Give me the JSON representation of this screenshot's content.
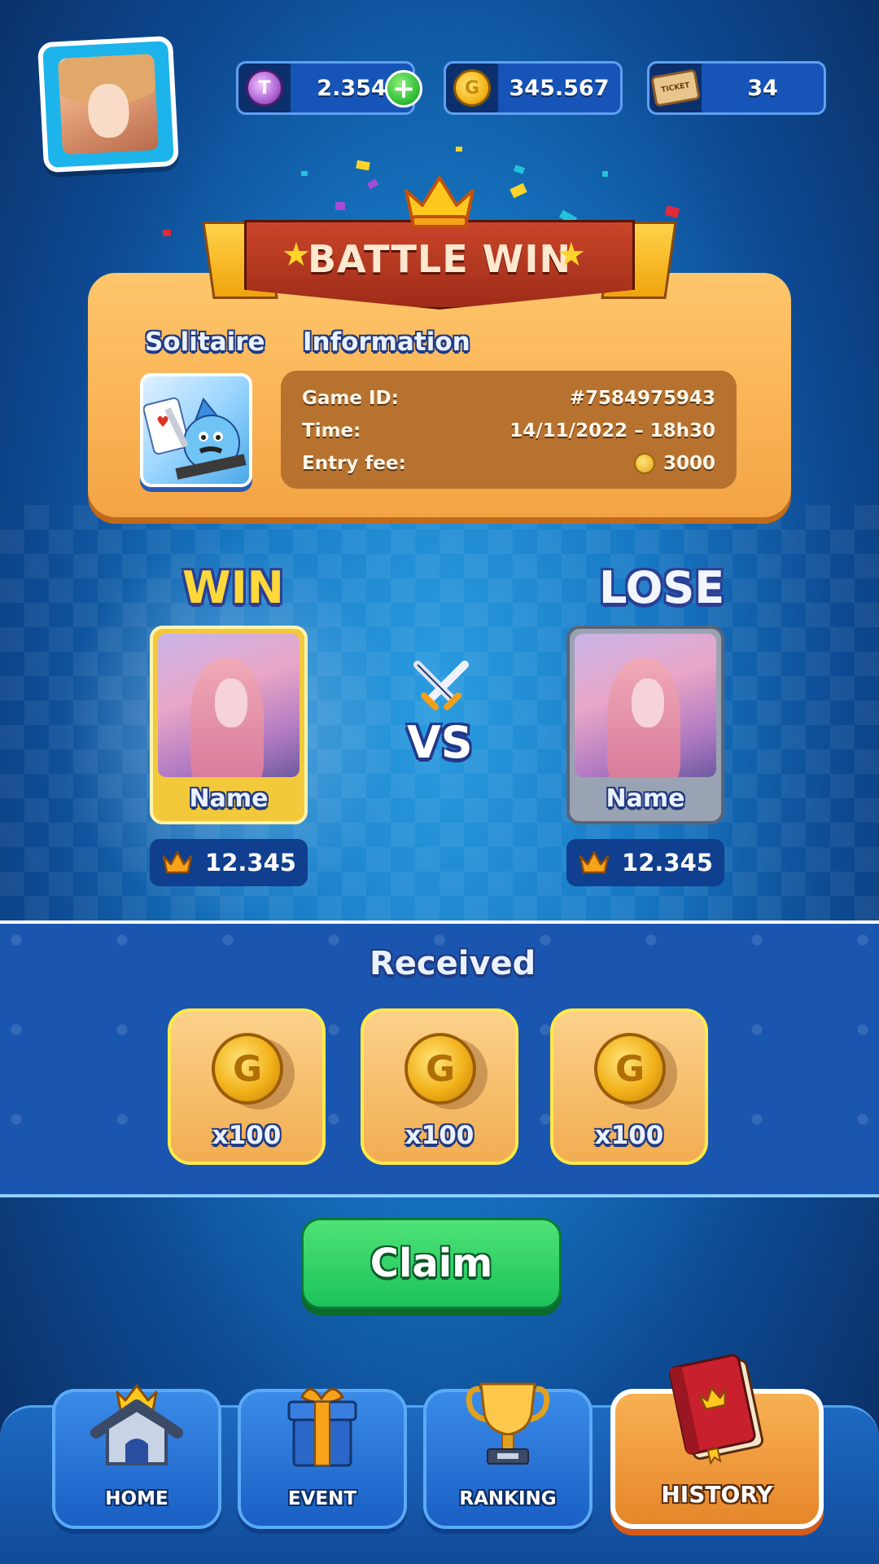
{
  "top_bar": {
    "gems": "2.354",
    "coins": "345.567",
    "tickets": "34",
    "ticket_icon_text": "TICKET"
  },
  "banner": {
    "title": "BATTLE WIN"
  },
  "game": {
    "name": "Solitaire",
    "info_title": "Information",
    "rows": [
      {
        "label": "Game ID:",
        "value": "#7584975943"
      },
      {
        "label": "Time:",
        "value": "14/11/2022 – 18h30"
      },
      {
        "label": "Entry fee:",
        "value": "3000"
      }
    ]
  },
  "battle": {
    "winner": {
      "result": "WIN",
      "name": "Name",
      "score": "12.345"
    },
    "loser": {
      "result": "LOSE",
      "name": "Name",
      "score": "12.345"
    },
    "vs": "VS"
  },
  "received": {
    "title": "Received",
    "rewards": [
      {
        "qty": "x100",
        "icon": "gold-coin"
      },
      {
        "qty": "x100",
        "icon": "gold-coin"
      },
      {
        "qty": "x100",
        "icon": "gold-coin"
      }
    ]
  },
  "claim_label": "Claim",
  "nav": {
    "items": [
      {
        "label": "HOME",
        "icon": "home-icon"
      },
      {
        "label": "EVENT",
        "icon": "gift-icon"
      },
      {
        "label": "RANKING",
        "icon": "trophy-icon"
      },
      {
        "label": "HISTORY",
        "icon": "book-icon",
        "active": true
      }
    ]
  },
  "colors": {
    "win_yellow": "#ffd93a",
    "lose_white": "#f2f6ff",
    "claim_green": "#2ad163",
    "active_orange": "#f0a040"
  }
}
